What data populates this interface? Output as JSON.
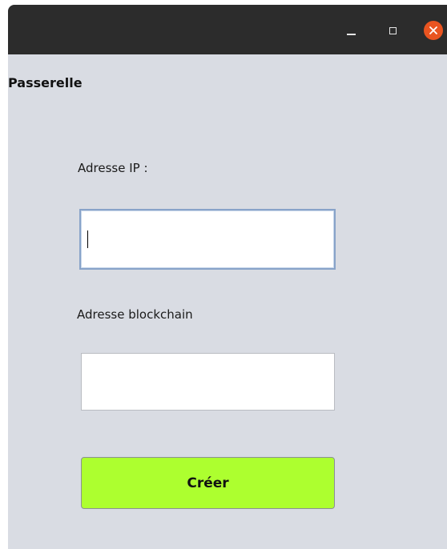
{
  "window": {
    "controls": {
      "minimize_icon": "minimize-icon",
      "maximize_icon": "maximize-icon",
      "close_icon": "close-icon",
      "close_color": "#e95420"
    }
  },
  "app": {
    "title": "Passerelle"
  },
  "form": {
    "ip_label": "Adresse IP :",
    "ip_value": "",
    "blockchain_label": "Adresse blockchain",
    "blockchain_value": "",
    "submit_label": "Créer",
    "submit_color": "#adff2f"
  }
}
